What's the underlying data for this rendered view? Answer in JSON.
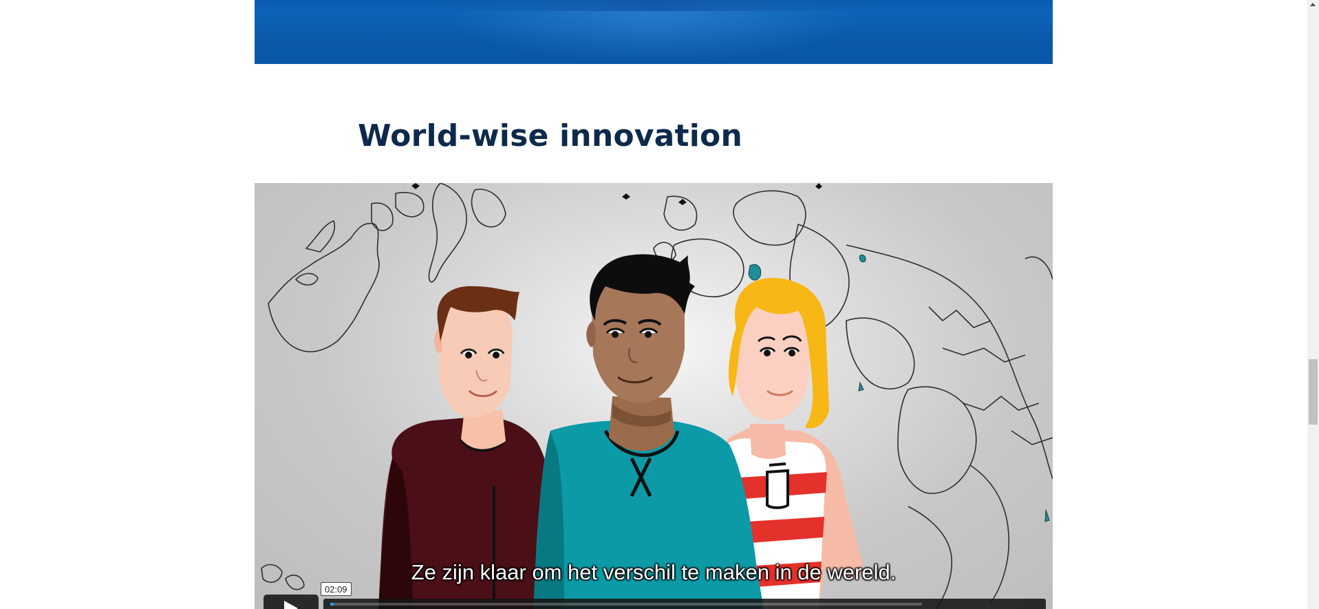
{
  "section": {
    "title": "World-wise innovation"
  },
  "video": {
    "subtitle": "Ze zijn klaar om het verschil te maken in de wereld.",
    "time_tooltip": "02:09",
    "progress_fraction": 0.006,
    "accent_color": "#19a6ff"
  },
  "colors": {
    "banner_blue": "#0a5bb0",
    "title_navy": "#0d2a4d"
  },
  "icons": {
    "play": "play-icon",
    "volume": "volume-icon",
    "settings": "gear-icon"
  }
}
